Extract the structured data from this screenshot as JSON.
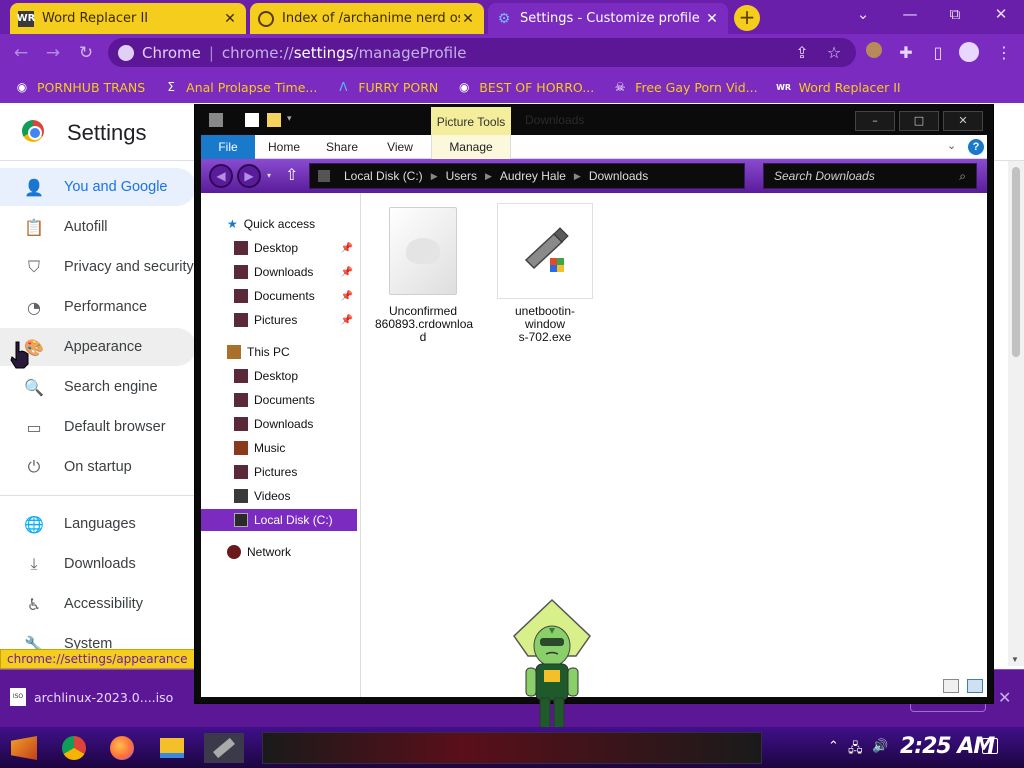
{
  "browser": {
    "tabs": [
      {
        "label": "Word Replacer II",
        "favicon": "WR",
        "active": false
      },
      {
        "label": "Index of /archanime nerd os/Į",
        "favicon": "globe",
        "active": false
      },
      {
        "label": "Settings - Customize profile",
        "favicon": "gear",
        "active": true
      }
    ],
    "new_tab": "+",
    "window_controls": {
      "dropdown": "⌄",
      "minimize": "—",
      "maximize": "⧉",
      "close": "✕"
    },
    "omnibox": {
      "site": "Chrome",
      "url_prefix": "chrome://",
      "url_host": "settings",
      "url_path": "/manageProfile"
    },
    "bookmarks": [
      {
        "label": "PORNHUB TRANS",
        "icon": "globe-icon"
      },
      {
        "label": "Anal Prolapse Time...",
        "icon": "sigma-icon"
      },
      {
        "label": "FURRY PORN",
        "icon": "lambda-icon"
      },
      {
        "label": "BEST OF HORRO...",
        "icon": "globe-icon"
      },
      {
        "label": "Free Gay Porn Vid...",
        "icon": "skull-icon"
      },
      {
        "label": "Word Replacer II",
        "icon": "wr-icon"
      }
    ],
    "colors": {
      "tabstrip": "#6a1faa",
      "toolbar": "#7b2bc0",
      "accent_yellow": "#f5cd1c"
    }
  },
  "settings": {
    "title": "Settings",
    "sidebar": [
      {
        "label": "You and Google",
        "icon": "person-icon",
        "selected": true
      },
      {
        "label": "Autofill",
        "icon": "clipboard-icon"
      },
      {
        "label": "Privacy and security",
        "icon": "shield-icon"
      },
      {
        "label": "Performance",
        "icon": "gauge-icon"
      },
      {
        "label": "Appearance",
        "icon": "palette-icon",
        "hover": true
      },
      {
        "label": "Search engine",
        "icon": "search-icon"
      },
      {
        "label": "Default browser",
        "icon": "browser-icon"
      },
      {
        "label": "On startup",
        "icon": "power-icon"
      },
      {
        "label": "Languages",
        "icon": "globe-icon"
      },
      {
        "label": "Downloads",
        "icon": "download-icon"
      },
      {
        "label": "Accessibility",
        "icon": "accessibility-icon"
      },
      {
        "label": "System",
        "icon": "wrench-icon"
      }
    ],
    "status_url": "chrome://settings/appearance"
  },
  "download_bar": {
    "items": [
      {
        "label": "archlinux-2023.0....iso",
        "icon_text": "ISO"
      }
    ],
    "close": "✕"
  },
  "explorer": {
    "title": "Downloads",
    "picture_tools": "Picture Tools",
    "ribbon_tabs": [
      "File",
      "Home",
      "Share",
      "View",
      "Manage"
    ],
    "controls": {
      "minimize": "–",
      "maximize": "□",
      "close": "✕"
    },
    "breadcrumb": [
      "Local Disk (C:)",
      "Users",
      "Audrey Hale",
      "Downloads"
    ],
    "search_placeholder": "Search Downloads",
    "nav": {
      "quick_access": {
        "label": "Quick access",
        "items": [
          "Desktop",
          "Downloads",
          "Documents",
          "Pictures"
        ]
      },
      "this_pc": {
        "label": "This PC",
        "items": [
          "Desktop",
          "Documents",
          "Downloads",
          "Music",
          "Pictures",
          "Videos",
          "Local Disk (C:)"
        ]
      },
      "network": {
        "label": "Network"
      }
    },
    "files": [
      {
        "name": "Unconfirmed 860893.crdownload",
        "line1": "Unconfirmed",
        "line2": "860893.crdownloa",
        "line3": "d",
        "icon": "generic-file-icon"
      },
      {
        "name": "unetbootin-windows-702.exe",
        "line1": "unetbootin-window",
        "line2": "s-702.exe",
        "icon": "usb-installer-icon"
      }
    ]
  },
  "taskbar": {
    "apps": [
      "start-icon",
      "chrome-icon",
      "firefox-icon",
      "file-explorer-icon",
      "usb-installer-icon"
    ],
    "clock": "2:25 AM"
  }
}
